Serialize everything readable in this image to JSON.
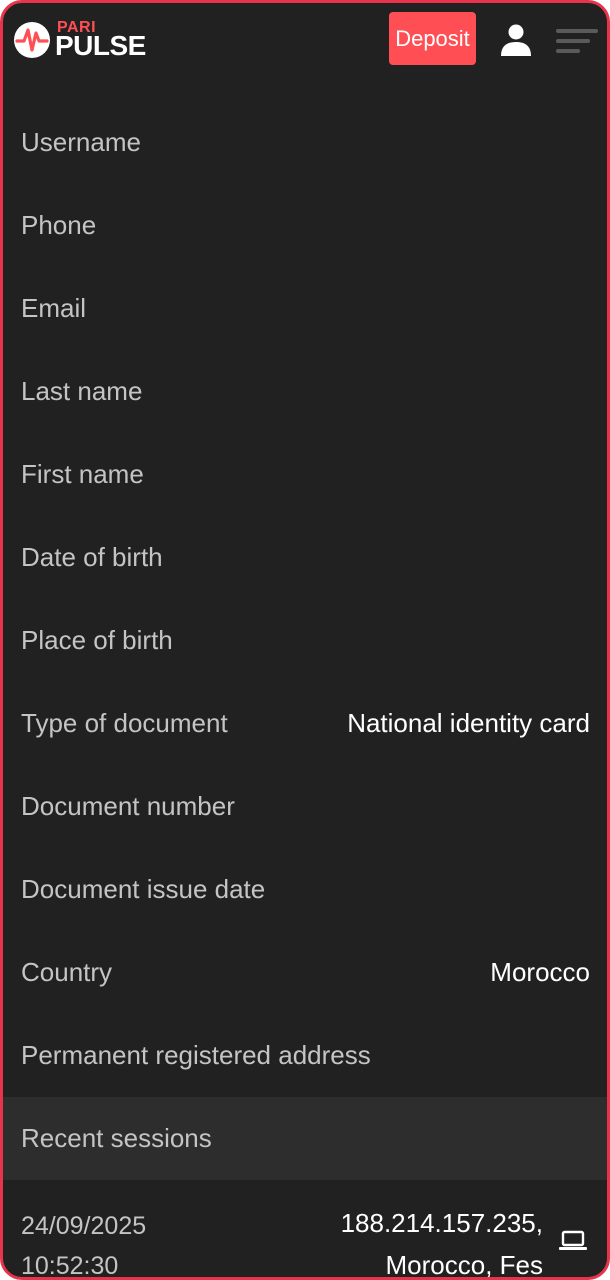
{
  "header": {
    "logo_top": "PARI",
    "logo_main": "PULSE",
    "deposit_label": "Deposit",
    "user_icon": "user-icon",
    "menu_icon": "menu-icon"
  },
  "profile_fields": [
    {
      "label": "Username",
      "value": ""
    },
    {
      "label": "Phone",
      "value": ""
    },
    {
      "label": "Email",
      "value": ""
    },
    {
      "label": "Last name",
      "value": ""
    },
    {
      "label": "First name",
      "value": ""
    },
    {
      "label": "Date of birth",
      "value": ""
    },
    {
      "label": "Place of birth",
      "value": ""
    },
    {
      "label": "Type of document",
      "value": "National identity card"
    },
    {
      "label": "Document number",
      "value": ""
    },
    {
      "label": "Document issue date",
      "value": ""
    },
    {
      "label": "Country",
      "value": "Morocco"
    },
    {
      "label": "Permanent registered address",
      "value": ""
    }
  ],
  "recent_sessions": {
    "title": "Recent sessions",
    "items": [
      {
        "date": "24/09/2025",
        "time": "10:52:30",
        "ip": "188.214.157.235,",
        "location": "Morocco, Fes",
        "device_icon": "laptop-icon"
      }
    ]
  },
  "colors": {
    "accent": "#ff4f55",
    "background": "#212121",
    "section_background": "#2d2d2d",
    "label_text": "#c4c4c4",
    "value_text": "#ffffff",
    "frame_border": "#e8334a"
  }
}
